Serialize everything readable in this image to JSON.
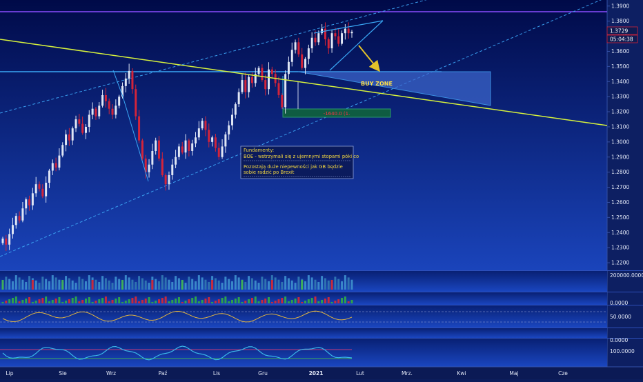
{
  "chart_data": [
    {
      "type": "candlestick",
      "title": "",
      "price_axis": {
        "ticks": [
          "1.3900",
          "1.3800",
          "1.3700",
          "1.3600",
          "1.3500",
          "1.3400",
          "1.3300",
          "1.3200",
          "1.3100",
          "1.3000",
          "1.2900",
          "1.2800",
          "1.2700",
          "1.2600",
          "1.2500",
          "1.2400",
          "1.2300",
          "1.2200"
        ],
        "ylim": [
          1.215,
          1.394
        ]
      },
      "time_axis": {
        "labels": [
          "Lip",
          "Sie",
          "Wrz",
          "Paź",
          "Lis",
          "Gru",
          "2021",
          "Lut",
          "Mrz.",
          "Kwi",
          "Maj",
          "Cze"
        ],
        "bold_label": "2021"
      },
      "last_price": "1.3729",
      "countdown": "05:04:38",
      "closes": [
        1.236,
        1.232,
        1.239,
        1.245,
        1.251,
        1.248,
        1.256,
        1.262,
        1.258,
        1.266,
        1.272,
        1.269,
        1.264,
        1.273,
        1.281,
        1.286,
        1.283,
        1.291,
        1.298,
        1.305,
        1.301,
        1.309,
        1.315,
        1.312,
        1.306,
        1.31,
        1.318,
        1.322,
        1.317,
        1.324,
        1.331,
        1.327,
        1.322,
        1.318,
        1.324,
        1.33,
        1.337,
        1.342,
        1.347,
        1.335,
        1.317,
        1.301,
        1.289,
        1.28,
        1.285,
        1.294,
        1.301,
        1.289,
        1.278,
        1.272,
        1.278,
        1.285,
        1.29,
        1.297,
        1.293,
        1.301,
        1.294,
        1.299,
        1.303,
        1.309,
        1.314,
        1.308,
        1.3,
        1.303,
        1.296,
        1.29,
        1.297,
        1.305,
        1.311,
        1.318,
        1.325,
        1.333,
        1.341,
        1.333,
        1.343,
        1.339,
        1.345,
        1.349,
        1.341,
        1.335,
        1.348,
        1.345,
        1.339,
        1.331,
        1.323,
        1.345,
        1.353,
        1.361,
        1.366,
        1.358,
        1.349,
        1.355,
        1.362,
        1.369,
        1.366,
        1.372,
        1.375,
        1.368,
        1.362,
        1.372,
        1.37,
        1.365,
        1.372,
        1.375,
        1.372,
        1.373
      ],
      "annotations": {
        "zone_label": "BUY ZONE",
        "stop_label": "-1640.0 (1.",
        "fundamentals_title": "Fundamenty:",
        "fundamentals_line1": "BOE - wstrzymali się z ujemnymi stopami póki co",
        "fundamentals_line2": "Pozostają duże niepewności jak GB będzie",
        "fundamentals_line3": "sobie radzić po Brexit"
      },
      "levels": {
        "resistance_purple": 1.3855,
        "horizontal_support": 1.3447,
        "zone_top": 1.3445,
        "zone_bottom": 1.3225
      }
    },
    {
      "type": "bar",
      "title": "",
      "axis_labels": [
        "200000.0000"
      ]
    },
    {
      "type": "bar",
      "title": "",
      "axis_labels": [
        "0.0000"
      ]
    },
    {
      "type": "line",
      "title": "",
      "axis_labels": [
        "50.0000"
      ]
    },
    {
      "type": "line",
      "title": "",
      "axis_labels": [
        "0.0000",
        "100.0000"
      ]
    }
  ],
  "colors": {
    "bg_top": "#000a48",
    "bg_bottom": "#1940b4",
    "candle_up": "#dfe6f5",
    "candle_down": "#d3243a",
    "trendline_yellow": "#d7f23c",
    "channel_line": "#2aa0ee",
    "purple_line": "#8a4dff",
    "zone_fill": "#3a63c7",
    "stop_fill": "#0f5c42",
    "axis_text": "#e6ebf8",
    "arrow": "#e3c22a"
  }
}
